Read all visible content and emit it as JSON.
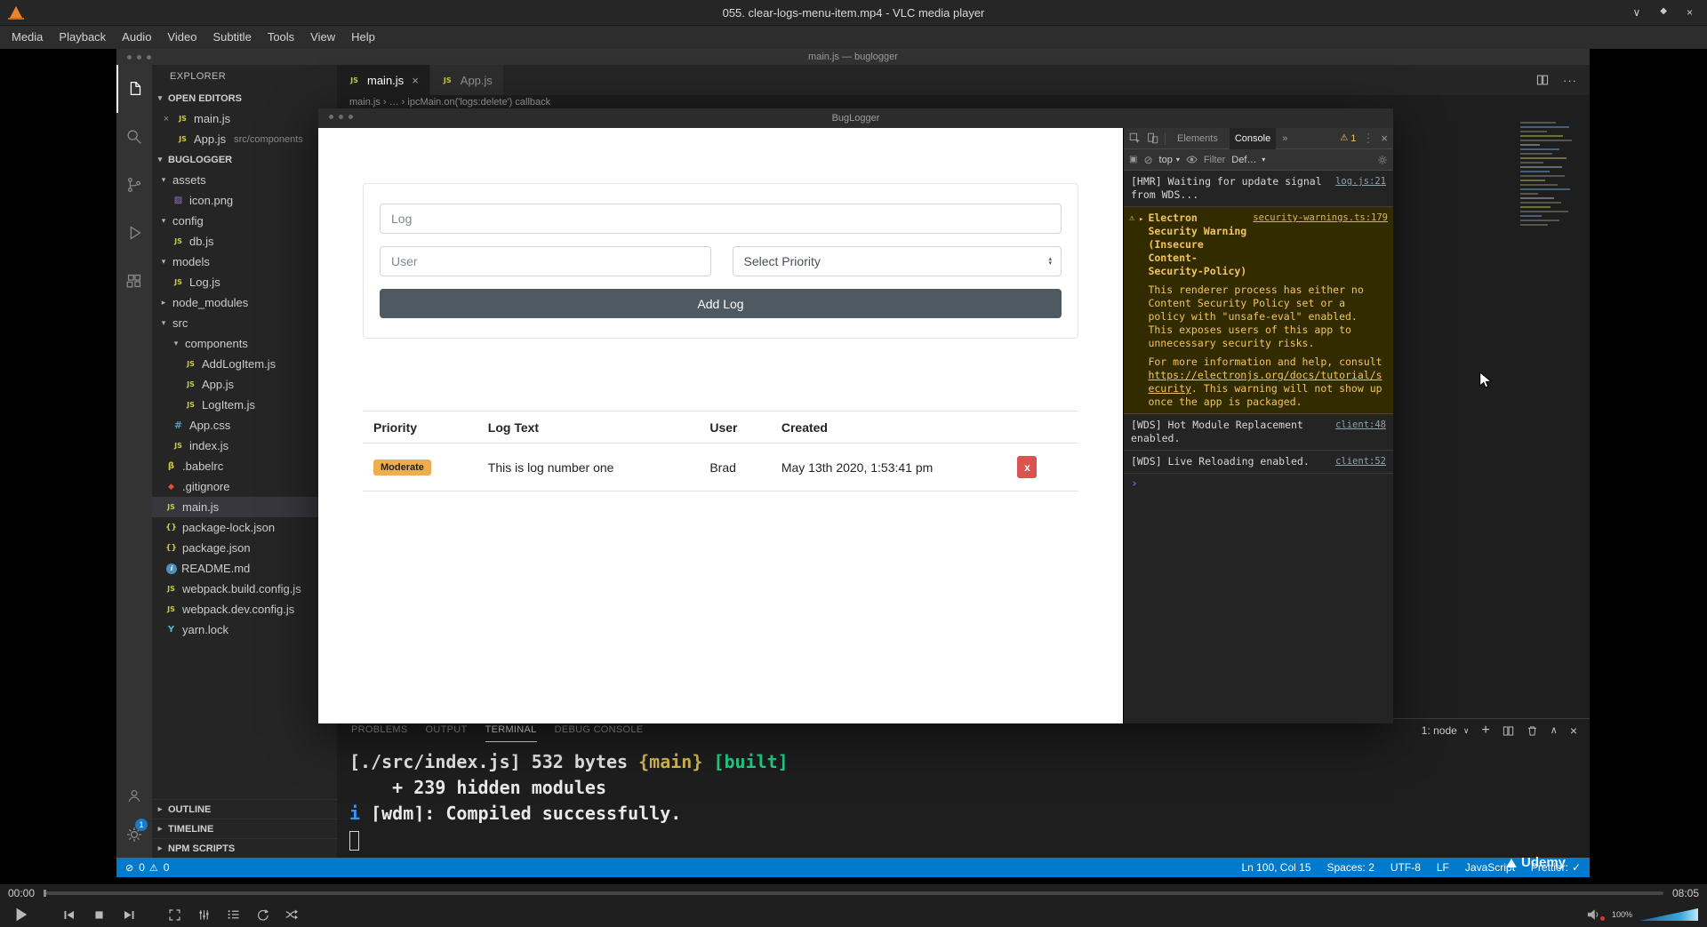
{
  "glyphs": {
    "caret_down": "▾",
    "caret_right": "▸",
    "caret_up": "▴",
    "chevron_down": "∨",
    "chevron_up": "∧",
    "close": "×",
    "plus": "+",
    "more_h": "···",
    "clear": "⊘",
    "dock": "▣",
    "error": "⊘",
    "warn": "⚠",
    "check": "✓",
    "more_chevrons": "»"
  },
  "vlc": {
    "window_title": "055. clear-logs-menu-item.mp4 - VLC media player",
    "minimize_glyph": "∨",
    "maximize_glyph": "◆",
    "close_glyph": "×",
    "menu_items": [
      "Media",
      "Playback",
      "Audio",
      "Video",
      "Subtitle",
      "Tools",
      "View",
      "Help"
    ],
    "time_elapsed": "00:00",
    "time_total": "08:05",
    "volume_percent": "100%"
  },
  "vscode": {
    "window_title": "main.js — buglogger",
    "activity_badge": "1",
    "explorer": {
      "header": "EXPLORER",
      "open_editors_label": "OPEN EDITORS",
      "project_label": "BUGLOGGER",
      "open_editors": [
        {
          "close": "×",
          "icon": "JS",
          "name": "main.js"
        },
        {
          "icon": "JS",
          "name": "App.js",
          "detail": "src/components"
        }
      ],
      "tree": [
        {
          "arrow": "▾",
          "name": "assets"
        },
        {
          "icon": "▨",
          "name": "icon.png"
        },
        {
          "arrow": "▾",
          "name": "config"
        },
        {
          "icon": "JS",
          "name": "db.js"
        },
        {
          "arrow": "▾",
          "name": "models"
        },
        {
          "icon": "JS",
          "name": "Log.js"
        },
        {
          "arrow": "▸",
          "name": "node_modules"
        },
        {
          "arrow": "▾",
          "name": "src"
        },
        {
          "arrow": "▾",
          "name": "components"
        },
        {
          "icon": "JS",
          "name": "AddLogItem.js"
        },
        {
          "icon": "JS",
          "name": "App.js"
        },
        {
          "icon": "JS",
          "name": "LogItem.js"
        },
        {
          "icon": "#",
          "name": "App.css"
        },
        {
          "icon": "JS",
          "name": "index.js"
        },
        {
          "icon": "β",
          "name": ".babelrc"
        },
        {
          "icon": "◆",
          "name": ".gitignore"
        },
        {
          "icon": "JS",
          "name": "main.js"
        },
        {
          "icon": "{}",
          "name": "package-lock.json"
        },
        {
          "icon": "{}",
          "name": "package.json"
        },
        {
          "icon": "i",
          "name": "README.md"
        },
        {
          "icon": "JS",
          "name": "webpack.build.config.js"
        },
        {
          "icon": "JS",
          "name": "webpack.dev.config.js"
        },
        {
          "icon": "Y",
          "name": "yarn.lock"
        }
      ],
      "outline_label": "OUTLINE",
      "timeline_label": "TIMELINE",
      "npm_label": "NPM SCRIPTS"
    },
    "tabs": [
      {
        "icon": "JS",
        "label": "main.js",
        "close": "×"
      },
      {
        "icon": "JS",
        "label": "App.js"
      }
    ],
    "breadcrumb": "main.js  ›  …  ›  ipcMain.on('logs:delete') callback",
    "panel": {
      "problems": "PROBLEMS",
      "output": "OUTPUT",
      "terminal": "TERMINAL",
      "debug": "DEBUG CONSOLE",
      "shell_selector": "1: node",
      "terminal_lines": {
        "l1_pre": "[./src/index.js] 532 bytes ",
        "l1_chunk": "{main}",
        "l1_sep": " ",
        "l1_built": "[built]",
        "l2": "    + 239 hidden modules",
        "l3_icon": "i",
        "l3_text": " ⌈wdm⌉: Compiled successfully."
      }
    },
    "status": {
      "errors": "0",
      "warnings": "0",
      "line_col": "Ln 100, Col 15",
      "spaces": "Spaces: 2",
      "encoding": "UTF-8",
      "eol": "LF",
      "language": "JavaScript",
      "prettier": "Prettier:",
      "check": "✓"
    }
  },
  "buglogger": {
    "window_title": "BugLogger",
    "form": {
      "log_placeholder": "Log",
      "user_placeholder": "User",
      "priority_value": "Select Priority",
      "submit_label": "Add Log"
    },
    "table": {
      "headers": [
        "Priority",
        "Log Text",
        "User",
        "Created"
      ],
      "row": {
        "priority": "Moderate",
        "text": "This is log number one",
        "user": "Brad",
        "created": "May 13th 2020, 1:53:41 pm",
        "delete_label": "x"
      }
    }
  },
  "devtools": {
    "tab_elements": "Elements",
    "tab_console": "Console",
    "warning_badge": "1",
    "context": "top",
    "filter": "Filter",
    "levels": "Default levels",
    "entries": {
      "hmr": {
        "text": "[HMR] Waiting for update signal from WDS...",
        "link": "log.js:21"
      },
      "security": {
        "title": "Electron Security Warning (Insecure Content-Security-Policy)",
        "body": "This renderer process has either no Content Security Policy set or a policy with \"unsafe-eval\" enabled. This exposes users of this app to unnecessary security risks.",
        "more_pre": "For more information and help, consult ",
        "url": "https://electronjs.org/docs/tutorial/security",
        "more_post": ". This warning will not show up once the app is packaged.",
        "link": "security-warnings.ts:179"
      },
      "wds1": {
        "text": "[WDS] Hot Module Replacement enabled.",
        "link": "client:48"
      },
      "wds2": {
        "text": "[WDS] Live Reloading enabled.",
        "link": "client:52"
      }
    },
    "prompt": "›"
  },
  "watermark": "Udemy"
}
